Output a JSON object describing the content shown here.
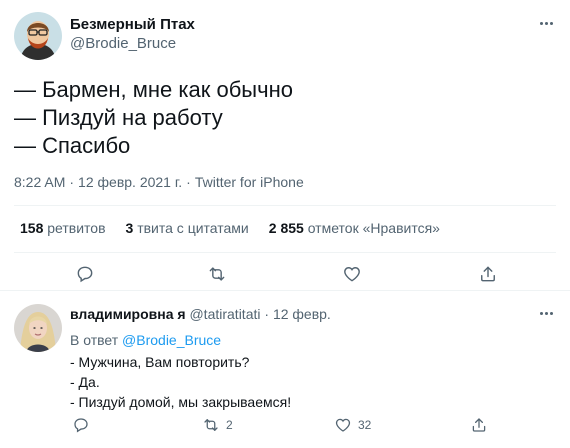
{
  "tweet": {
    "author_name": "Безмерный Птах",
    "author_handle": "@Brodie_Bruce",
    "lines": [
      "— Бармен, мне как обычно",
      "— Пиздуй на работу",
      "— Спасибо"
    ],
    "time": "8:22 AM",
    "date": "12 февр. 2021 г.",
    "source": "Twitter for iPhone",
    "separator": "·",
    "stats": {
      "retweets_count": "158",
      "retweets_label": "ретвитов",
      "quotes_count": "3",
      "quotes_label": "твита с цитатами",
      "likes_count": "2 855",
      "likes_label": "отметок «Нравится»"
    },
    "actions": [
      "reply-icon",
      "retweet-icon",
      "like-icon",
      "share-icon"
    ]
  },
  "reply": {
    "author_name": "владимировна я",
    "author_handle": "@tatiratitati",
    "separator": "·",
    "date": "12 февр.",
    "reply_to_prefix": "В ответ",
    "reply_to_handle": "@Brodie_Bruce",
    "lines": [
      "- Мужчина, Вам повторить?",
      "- Да.",
      "- Пиздуй домой, мы закрываемся!"
    ],
    "retweet_count": "2",
    "like_count": "32"
  },
  "colors": {
    "text": "#0f1419",
    "secondary": "#536471",
    "link": "#1d9bf0",
    "divider": "#eff3f4"
  }
}
